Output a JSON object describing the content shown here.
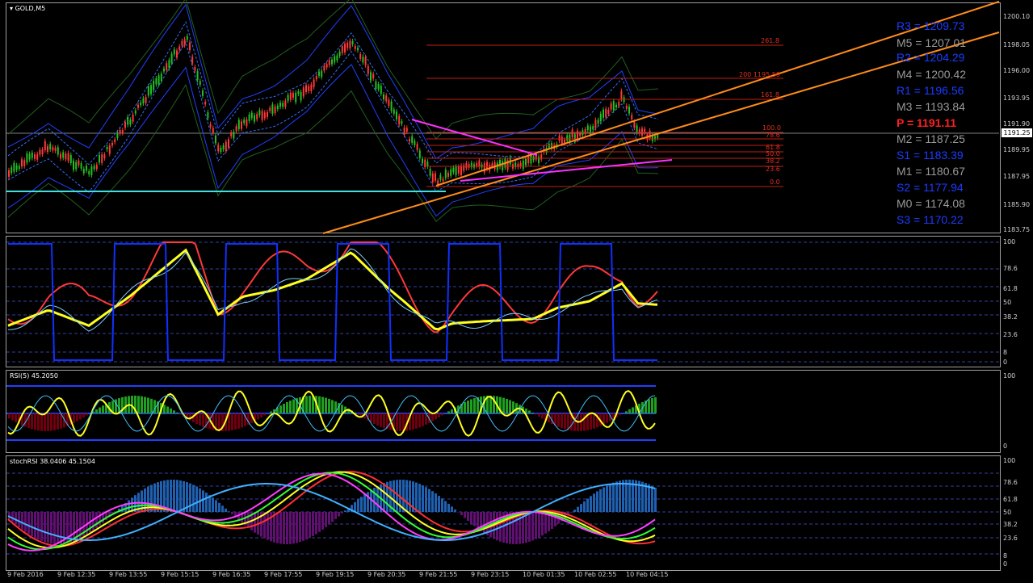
{
  "symbol_label": "GOLD,M5",
  "price_axis": [
    "1200.10",
    "1198.05",
    "1196.00",
    "1193.95",
    "1191.90",
    "1189.95",
    "1187.95",
    "1185.90",
    "1183.75"
  ],
  "current_price": "1191.25",
  "pivots": [
    {
      "text": "R3 = 1209.73",
      "color": "#1a3cff"
    },
    {
      "text": "M5 = 1207.01",
      "color": "#9a9a9a"
    },
    {
      "text": "R2 = 1204.29",
      "color": "#1a3cff"
    },
    {
      "text": "M4 = 1200.42",
      "color": "#9a9a9a"
    },
    {
      "text": "R1 = 1196.56",
      "color": "#1a3cff"
    },
    {
      "text": "M3 = 1193.84",
      "color": "#9a9a9a"
    },
    {
      "text": "P   = 1191.11",
      "color": "#ff2020"
    },
    {
      "text": "M2 = 1187.25",
      "color": "#9a9a9a"
    },
    {
      "text": "S1 = 1183.39",
      "color": "#1a3cff"
    },
    {
      "text": "M1 = 1180.67",
      "color": "#9a9a9a"
    },
    {
      "text": "S2 = 1177.94",
      "color": "#1a3cff"
    },
    {
      "text": "M0 = 1174.08",
      "color": "#9a9a9a"
    },
    {
      "text": "S3 = 1170.22",
      "color": "#1a3cff"
    }
  ],
  "fib_labels": [
    "261.8",
    "200 1195.50",
    "161.8",
    "100.0",
    "78.6",
    "61.8",
    "50.0",
    "38.2",
    "23.6",
    "0.0"
  ],
  "ind1_axis": [
    "100",
    "78.6",
    "61.8",
    "50",
    "38.2",
    "23.6",
    "8",
    "0"
  ],
  "rsi_label": "RSI(5) 45.2050",
  "rsi_axis": [
    "100",
    "0"
  ],
  "stoch_label": "stochRSI 38.0406 45.1504",
  "stoch_axis": [
    "100",
    "78.6",
    "61.8",
    "50",
    "38.2",
    "23.6",
    "8",
    "0"
  ],
  "time_axis": [
    "9 Feb 2016",
    "9 Feb 12:35",
    "9 Feb 13:55",
    "9 Feb 15:15",
    "9 Feb 16:35",
    "9 Feb 17:55",
    "9 Feb 19:15",
    "9 Feb 20:35",
    "9 Feb 21:55",
    "9 Feb 23:15",
    "10 Feb 01:35",
    "10 Feb 02:55",
    "10 Feb 04:15"
  ],
  "colors": {
    "bull": "#22c022",
    "bear": "#ff3838",
    "trend": "#ff8c1a",
    "triangle": "#ff30ff",
    "support": "#40e0e0",
    "ma_yellow": "#ffff20",
    "osc_blue": "#1030ff"
  }
}
